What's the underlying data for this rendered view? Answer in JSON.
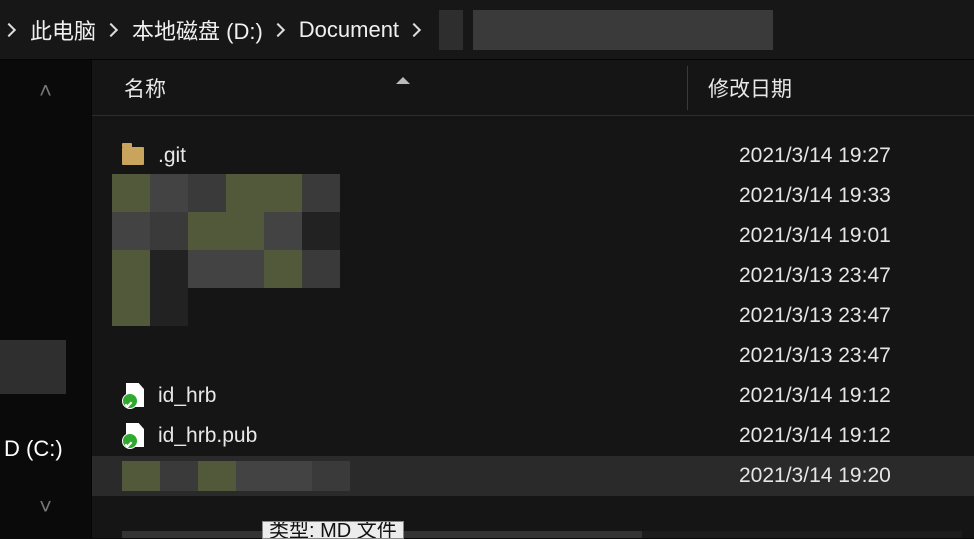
{
  "breadcrumb": {
    "items": [
      "此电脑",
      "本地磁盘 (D:)",
      "Document"
    ]
  },
  "nav": {
    "drive_c_label": "D (C:)"
  },
  "columns": {
    "name": "名称",
    "modified": "修改日期",
    "sort_column": "name",
    "sort_direction": "asc"
  },
  "rows": [
    {
      "name": ".git",
      "icon": "folder",
      "modified": "2021/3/14 19:27",
      "redacted": false
    },
    {
      "name": "",
      "icon": "folder",
      "modified": "2021/3/14 19:33",
      "redacted": true
    },
    {
      "name": "",
      "icon": "folder",
      "modified": "2021/3/14 19:01",
      "redacted": true
    },
    {
      "name": "",
      "icon": "folder",
      "modified": "2021/3/13 23:47",
      "redacted": true
    },
    {
      "name": "",
      "icon": "folder",
      "modified": "2021/3/13 23:47",
      "redacted": true
    },
    {
      "name": "",
      "icon": "folder",
      "modified": "2021/3/13 23:47",
      "redacted": true
    },
    {
      "name": "id_hrb",
      "icon": "key",
      "modified": "2021/3/14 19:12",
      "redacted": false
    },
    {
      "name": "id_hrb.pub",
      "icon": "key",
      "modified": "2021/3/14 19:12",
      "redacted": false
    },
    {
      "name": "",
      "icon": "file",
      "modified": "2021/3/14 19:20",
      "redacted": true,
      "hovered": true
    }
  ],
  "tooltip": {
    "text": "类型: MD 文件"
  }
}
